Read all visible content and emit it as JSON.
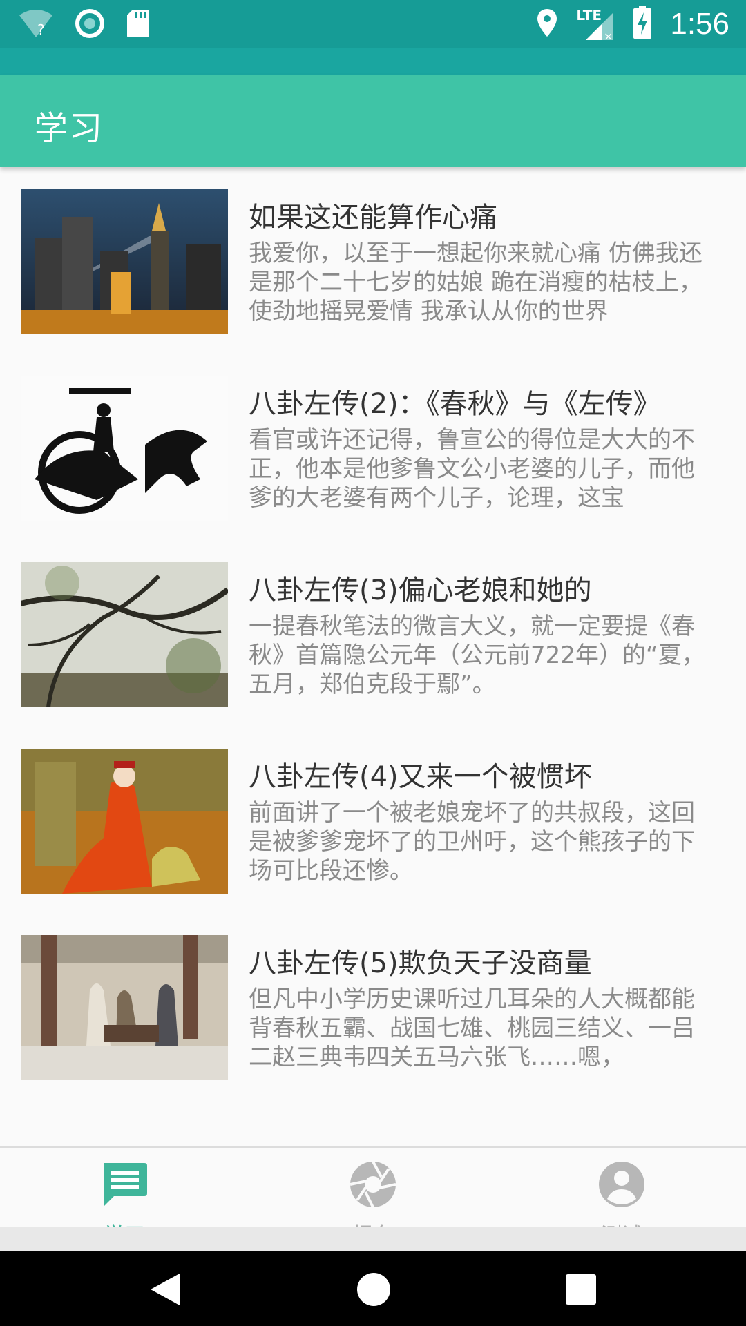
{
  "status_bar": {
    "time": "1:56",
    "network": "LTE",
    "icons": [
      "wifi-unknown-icon",
      "sync-icon",
      "sd-card-icon",
      "location-icon",
      "signal-icon",
      "battery-charging-icon"
    ]
  },
  "app_bar": {
    "title": "学习"
  },
  "items": [
    {
      "title": "如果这还能算作心痛",
      "desc": "我爱你，以至于一想起你来就心痛 仿佛我还是那个二十七岁的姑娘 跪在消瘦的枯枝上，使劲地摇晃爱情 我承认从你的世界"
    },
    {
      "title": "八卦左传(2)：《春秋》与《左传》",
      "desc": "看官或许还记得，鲁宣公的得位是大大的不正，他本是他爹鲁文公小老婆的儿子，而他爹的大老婆有两个儿子，论理，这宝"
    },
    {
      "title": "八卦左传(3)偏心老娘和她的",
      "desc": "一提春秋笔法的微言大义，就一定要提《春秋》首篇隐公元年（公元前722年）的“夏，五月，郑伯克段于鄢”。"
    },
    {
      "title": "八卦左传(4)又来一个被惯坏",
      "desc": "前面讲了一个被老娘宠坏了的共叔段，这回是被爹爹宠坏了的卫州吁，这个熊孩子的下场可比段还惨。"
    },
    {
      "title": "八卦左传(5)欺负天子没商量",
      "desc": "但凡中小学历史课听过几耳朵的人大概都能背春秋五霸、战国七雄、桃园三结义、一吕二赵三典韦四关五马六张飞……嗯，"
    }
  ],
  "bottom_nav": {
    "tabs": [
      {
        "label": "学习",
        "icon": "message-icon",
        "active": true
      },
      {
        "label": "报名",
        "icon": "aperture-icon",
        "active": false
      },
      {
        "label": "测试",
        "icon": "account-icon",
        "active": false
      }
    ],
    "active_color": "#3fb59a",
    "inactive_color": "#b0b0b0"
  },
  "colors": {
    "status_bar": "#169c96",
    "app_bar": "#3fc4a6"
  }
}
